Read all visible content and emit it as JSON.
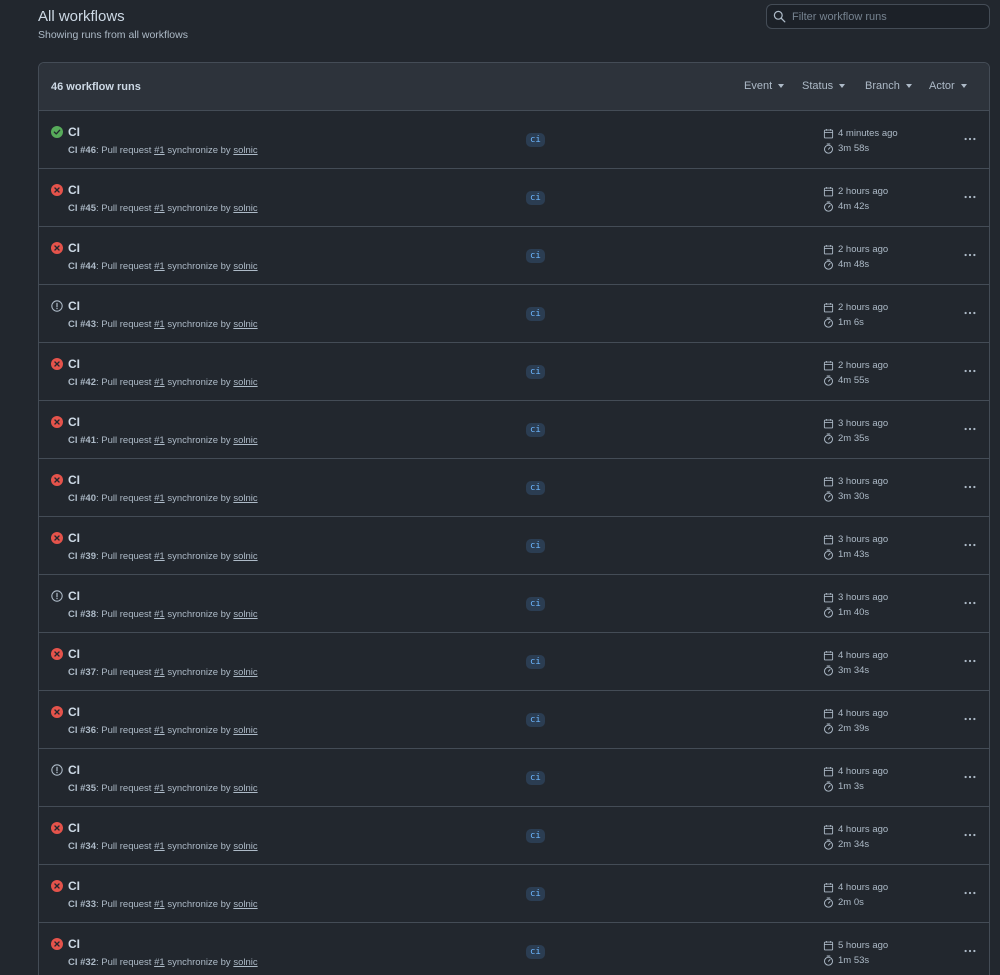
{
  "header": {
    "title": "All workflows",
    "subtitle": "Showing runs from all workflows"
  },
  "search": {
    "placeholder": "Filter workflow runs"
  },
  "runs_header": {
    "count_label": "46 workflow runs",
    "filters": [
      "Event",
      "Status",
      "Branch",
      "Actor"
    ]
  },
  "runs": [
    {
      "status": "success",
      "title": "CI",
      "workflow": "CI",
      "number": "#46",
      "event": "Pull request",
      "pr": "#1",
      "action": "synchronize by",
      "actor": "solnic",
      "branch": "ci",
      "time_ago": "4 minutes ago",
      "duration": "3m 58s"
    },
    {
      "status": "failure",
      "title": "CI",
      "workflow": "CI",
      "number": "#45",
      "event": "Pull request",
      "pr": "#1",
      "action": "synchronize by",
      "actor": "solnic",
      "branch": "ci",
      "time_ago": "2 hours ago",
      "duration": "4m 42s"
    },
    {
      "status": "failure",
      "title": "CI",
      "workflow": "CI",
      "number": "#44",
      "event": "Pull request",
      "pr": "#1",
      "action": "synchronize by",
      "actor": "solnic",
      "branch": "ci",
      "time_ago": "2 hours ago",
      "duration": "4m 48s"
    },
    {
      "status": "cancelled",
      "title": "CI",
      "workflow": "CI",
      "number": "#43",
      "event": "Pull request",
      "pr": "#1",
      "action": "synchronize by",
      "actor": "solnic",
      "branch": "ci",
      "time_ago": "2 hours ago",
      "duration": "1m 6s"
    },
    {
      "status": "failure",
      "title": "CI",
      "workflow": "CI",
      "number": "#42",
      "event": "Pull request",
      "pr": "#1",
      "action": "synchronize by",
      "actor": "solnic",
      "branch": "ci",
      "time_ago": "2 hours ago",
      "duration": "4m 55s"
    },
    {
      "status": "failure",
      "title": "CI",
      "workflow": "CI",
      "number": "#41",
      "event": "Pull request",
      "pr": "#1",
      "action": "synchronize by",
      "actor": "solnic",
      "branch": "ci",
      "time_ago": "3 hours ago",
      "duration": "2m 35s"
    },
    {
      "status": "failure",
      "title": "CI",
      "workflow": "CI",
      "number": "#40",
      "event": "Pull request",
      "pr": "#1",
      "action": "synchronize by",
      "actor": "solnic",
      "branch": "ci",
      "time_ago": "3 hours ago",
      "duration": "3m 30s"
    },
    {
      "status": "failure",
      "title": "CI",
      "workflow": "CI",
      "number": "#39",
      "event": "Pull request",
      "pr": "#1",
      "action": "synchronize by",
      "actor": "solnic",
      "branch": "ci",
      "time_ago": "3 hours ago",
      "duration": "1m 43s"
    },
    {
      "status": "cancelled",
      "title": "CI",
      "workflow": "CI",
      "number": "#38",
      "event": "Pull request",
      "pr": "#1",
      "action": "synchronize by",
      "actor": "solnic",
      "branch": "ci",
      "time_ago": "3 hours ago",
      "duration": "1m 40s"
    },
    {
      "status": "failure",
      "title": "CI",
      "workflow": "CI",
      "number": "#37",
      "event": "Pull request",
      "pr": "#1",
      "action": "synchronize by",
      "actor": "solnic",
      "branch": "ci",
      "time_ago": "4 hours ago",
      "duration": "3m 34s"
    },
    {
      "status": "failure",
      "title": "CI",
      "workflow": "CI",
      "number": "#36",
      "event": "Pull request",
      "pr": "#1",
      "action": "synchronize by",
      "actor": "solnic",
      "branch": "ci",
      "time_ago": "4 hours ago",
      "duration": "2m 39s"
    },
    {
      "status": "cancelled",
      "title": "CI",
      "workflow": "CI",
      "number": "#35",
      "event": "Pull request",
      "pr": "#1",
      "action": "synchronize by",
      "actor": "solnic",
      "branch": "ci",
      "time_ago": "4 hours ago",
      "duration": "1m 3s"
    },
    {
      "status": "failure",
      "title": "CI",
      "workflow": "CI",
      "number": "#34",
      "event": "Pull request",
      "pr": "#1",
      "action": "synchronize by",
      "actor": "solnic",
      "branch": "ci",
      "time_ago": "4 hours ago",
      "duration": "2m 34s"
    },
    {
      "status": "failure",
      "title": "CI",
      "workflow": "CI",
      "number": "#33",
      "event": "Pull request",
      "pr": "#1",
      "action": "synchronize by",
      "actor": "solnic",
      "branch": "ci",
      "time_ago": "4 hours ago",
      "duration": "2m 0s"
    },
    {
      "status": "failure",
      "title": "CI",
      "workflow": "CI",
      "number": "#32",
      "event": "Pull request",
      "pr": "#1",
      "action": "synchronize by",
      "actor": "solnic",
      "branch": "ci",
      "time_ago": "5 hours ago",
      "duration": "1m 53s"
    }
  ],
  "icons": {
    "success": "check-circle-icon",
    "failure": "x-circle-icon",
    "cancelled": "alert-circle-icon"
  },
  "colors": {
    "success": "#57ab5a",
    "failure": "#e5534b",
    "cancelled": "#adbac7",
    "branch_text": "#6cb6ff",
    "branch_bg": "#2b3d52"
  }
}
